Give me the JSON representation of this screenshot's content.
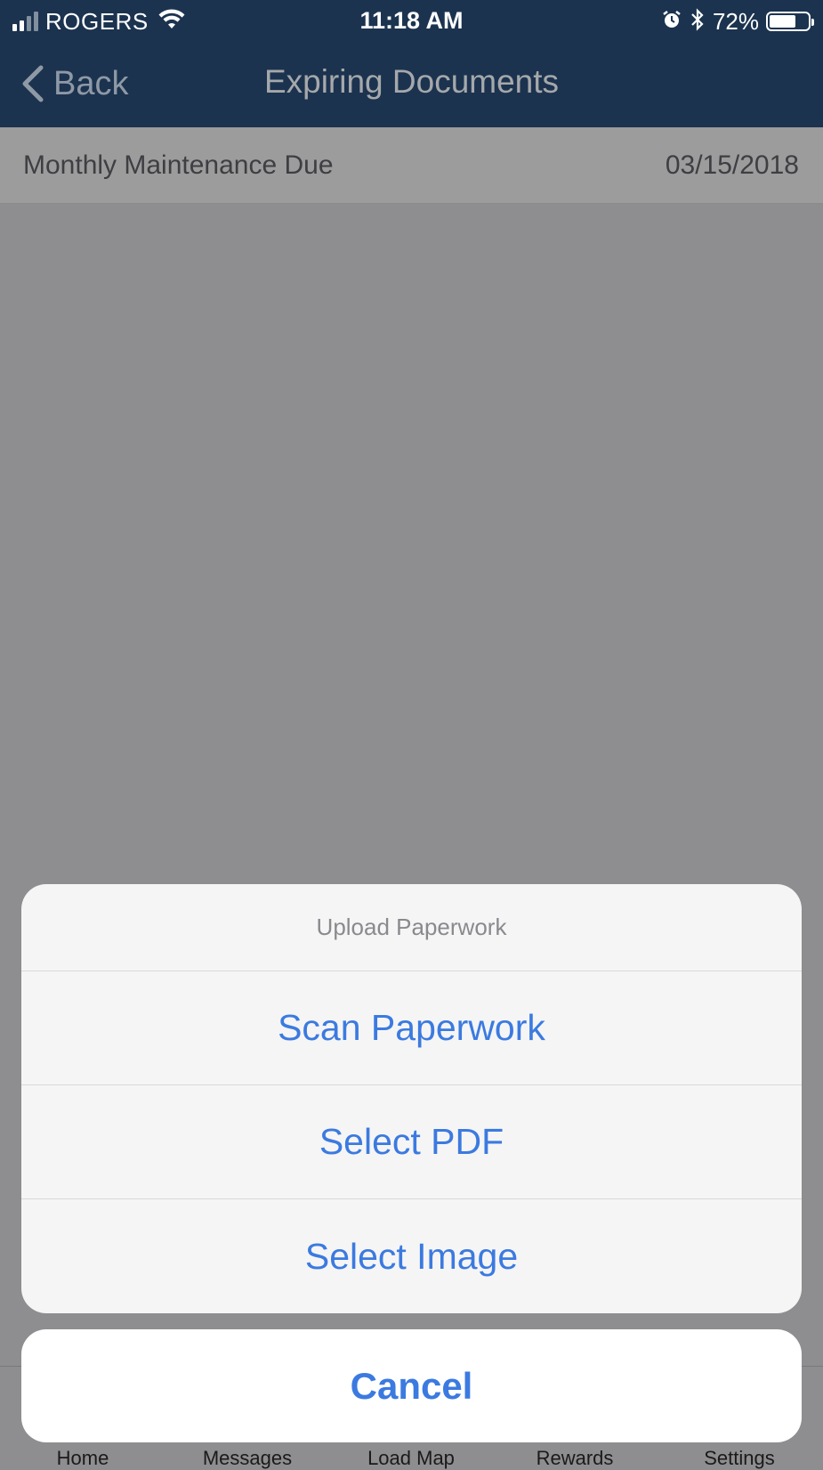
{
  "status_bar": {
    "carrier": "ROGERS",
    "time": "11:18 AM",
    "battery_percent": "72%",
    "battery_level": 0.72,
    "signal_bars_filled": 2,
    "icons": [
      "signal-icon",
      "wifi-icon",
      "alarm-icon",
      "bluetooth-icon",
      "battery-icon"
    ]
  },
  "nav": {
    "back_label": "Back",
    "title": "Expiring Documents"
  },
  "documents": [
    {
      "name": "Monthly Maintenance Due",
      "date": "03/15/2018"
    }
  ],
  "tab_bar": {
    "items": [
      {
        "label": "Home"
      },
      {
        "label": "Messages"
      },
      {
        "label": "Load Map"
      },
      {
        "label": "Rewards"
      },
      {
        "label": "Settings"
      }
    ]
  },
  "action_sheet": {
    "title": "Upload Paperwork",
    "options": [
      {
        "label": "Scan Paperwork"
      },
      {
        "label": "Select PDF"
      },
      {
        "label": "Select Image"
      }
    ],
    "cancel_label": "Cancel"
  },
  "colors": {
    "header_bg": "#1b334f",
    "action_blue": "#3b7ae0",
    "overlay_gray": "#8e8e90"
  }
}
